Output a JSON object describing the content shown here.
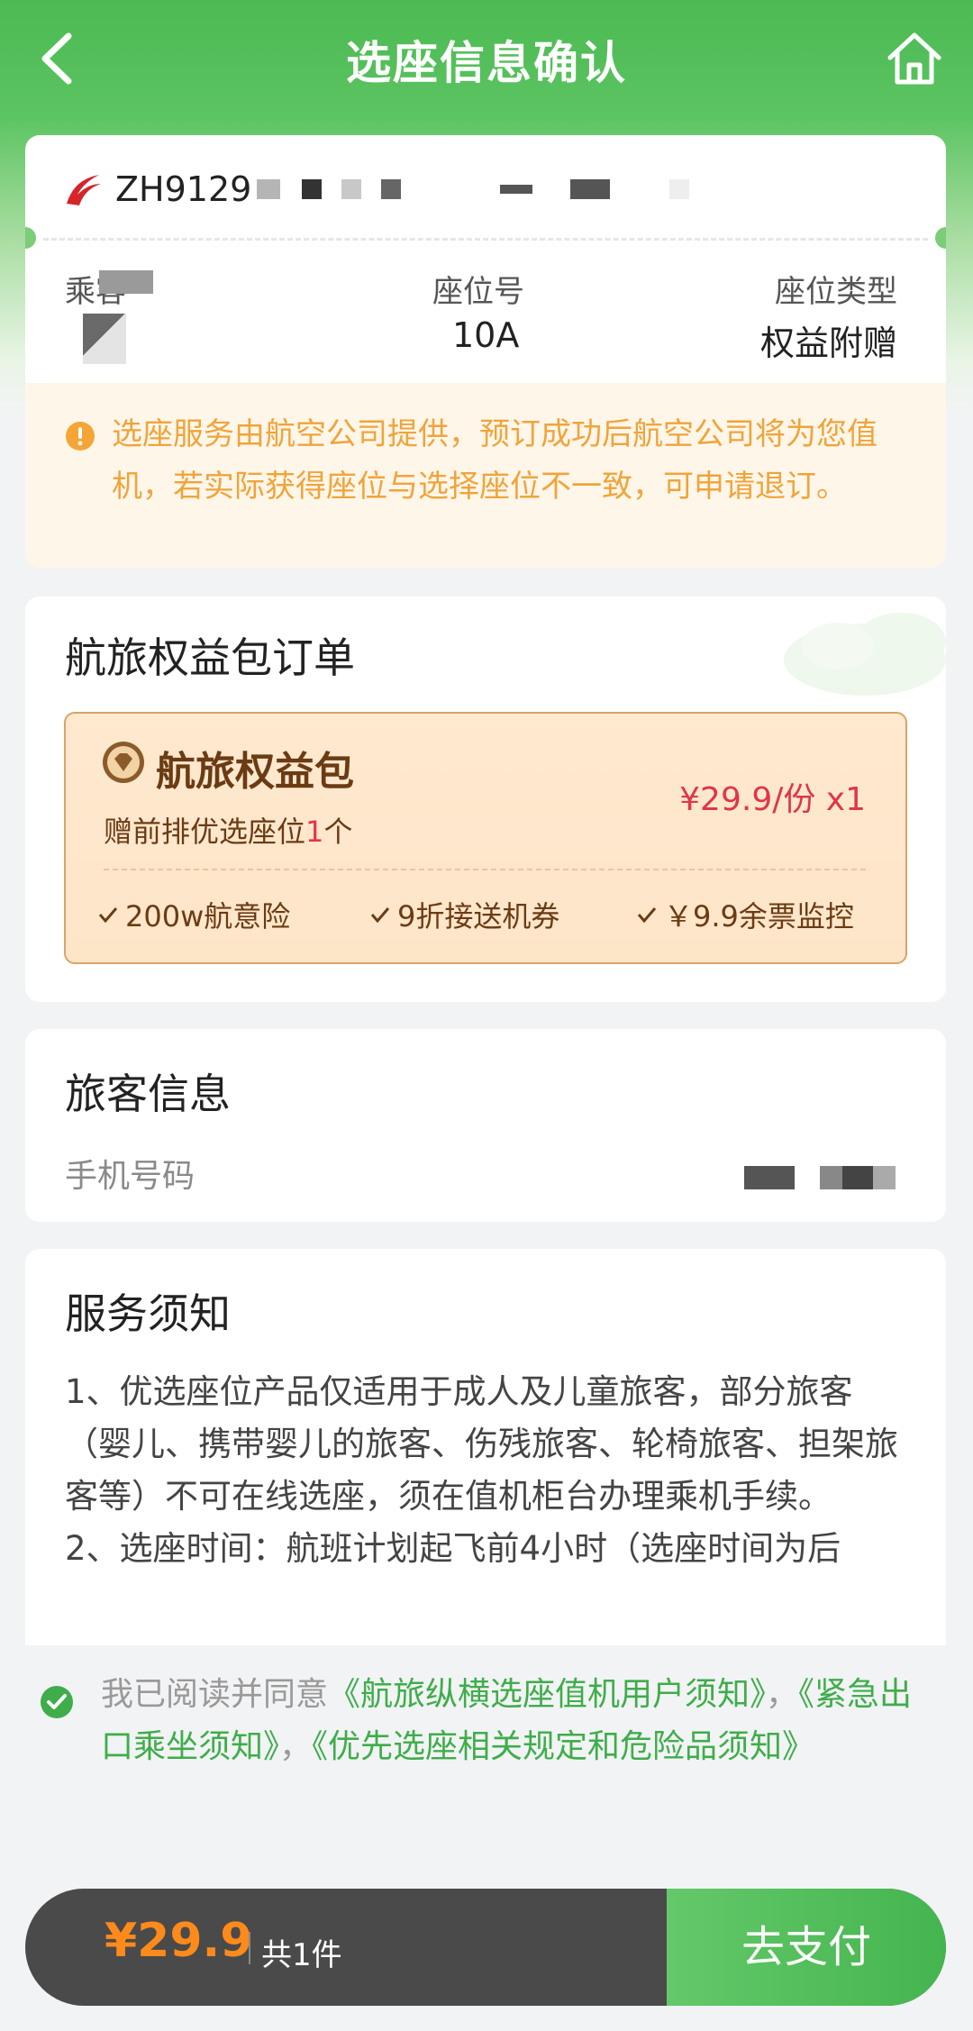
{
  "nav": {
    "title": "选座信息确认"
  },
  "flight": {
    "flight_no": "ZH9129",
    "headers": {
      "passenger": "乘客",
      "seat": "座位号",
      "type": "座位类型"
    },
    "seat": "10A",
    "seat_type": "权益附赠",
    "notice": "选座服务由航空公司提供，预订成功后航空公司将为您值机，若实际获得座位与选择座位不一致，可申请退订。"
  },
  "package": {
    "section_title": "航旅权益包订单",
    "name": "航旅权益包",
    "price": "¥29.9/份 x1",
    "desc_prefix": "赠前排优选座位",
    "desc_count": "1",
    "desc_suffix": "个",
    "perks": [
      "200w航意险",
      "9折接送机券",
      "￥9.9余票监控"
    ]
  },
  "passenger": {
    "section_title": "旅客信息",
    "phone_label": "手机号码"
  },
  "service": {
    "section_title": "服务须知",
    "p1": "1、优选座位产品仅适用于成人及儿童旅客，部分旅客（婴儿、携带婴儿的旅客、伤残旅客、轮椅旅客、担架旅客等）不可在线选座，须在值机柜台办理乘机手续。",
    "p2": "2、选座时间：航班计划起飞前4小时（选座时间为后"
  },
  "agreement": {
    "prefix": "我已阅读并同意",
    "link1": "《航旅纵横选座值机用户须知》",
    "sep1": "，",
    "link2": "《紧急出口乘坐须知》",
    "sep2": "，",
    "link3": "《优先选座相关规定和危险品须知》"
  },
  "paybar": {
    "amount": "¥29.9",
    "count": "共1件",
    "button": "去支付"
  },
  "colors": {
    "brand_green": "#4cba52",
    "price_red": "#e0354a",
    "pay_orange": "#ff8a1c",
    "warn_orange": "#f0a43a"
  }
}
